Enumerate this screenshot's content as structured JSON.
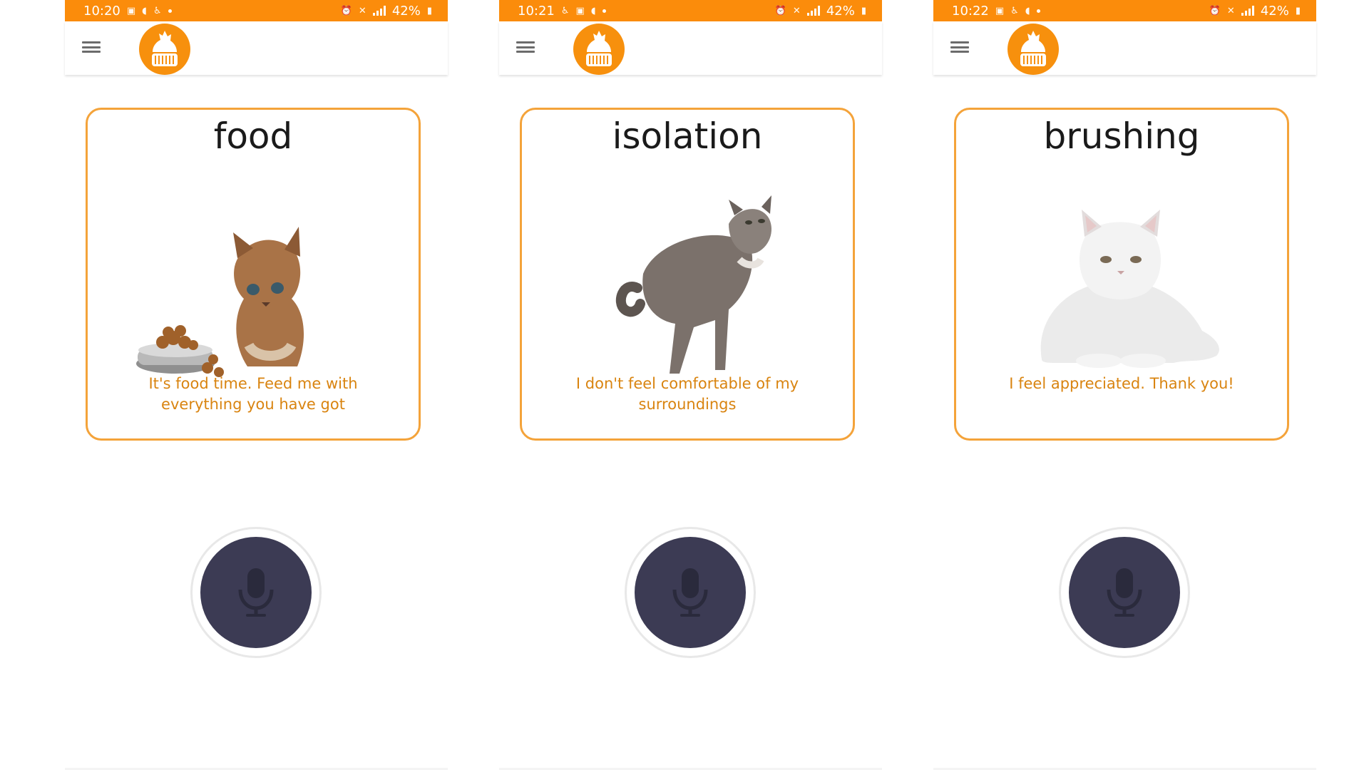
{
  "colors": {
    "brand_orange": "#fb8c0b",
    "card_border": "#f4a33a",
    "message_text": "#d98410",
    "mic_button": "#3c3b54",
    "mic_icon": "#2a2a3c"
  },
  "screens": [
    {
      "status": {
        "time": "10:20",
        "battery": "42%"
      },
      "card": {
        "title": "food",
        "message": "It's food time. Feed me with everything you have got",
        "image": "kitten-with-food-bowl"
      }
    },
    {
      "status": {
        "time": "10:21",
        "battery": "42%"
      },
      "card": {
        "title": "isolation",
        "message": "I don't feel comfortable of my surroundings",
        "image": "tabby-cat-looking-up"
      }
    },
    {
      "status": {
        "time": "10:22",
        "battery": "42%"
      },
      "card": {
        "title": "brushing",
        "message": "I feel appreciated. Thank you!",
        "image": "white-persian-cat-lying"
      }
    }
  ],
  "icons": {
    "menu": "hamburger-menu-icon",
    "logo": "cat-in-basket-logo",
    "mic": "microphone-icon"
  }
}
